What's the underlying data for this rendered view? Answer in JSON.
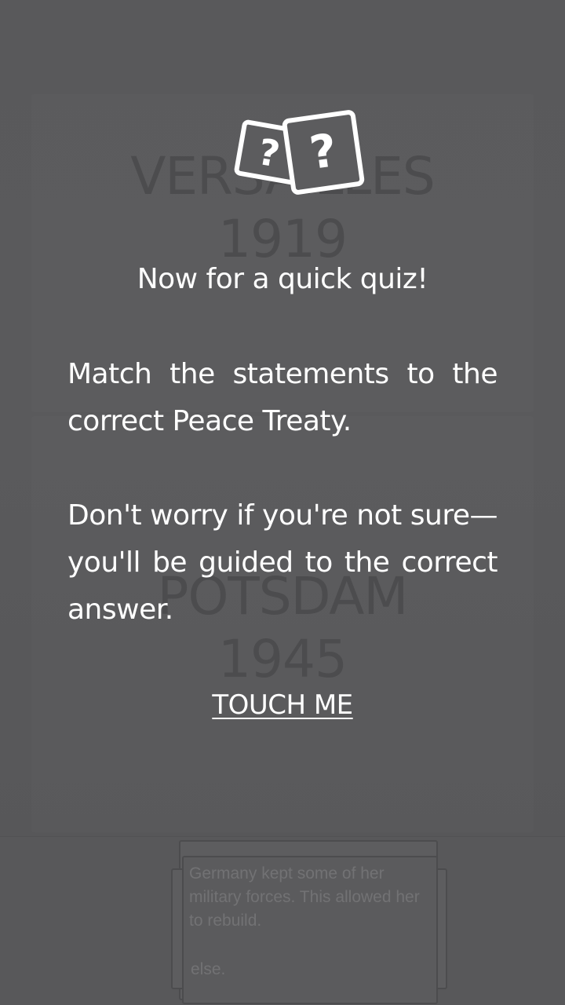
{
  "background": {
    "treaty_1": {
      "name": "VERSAILLES",
      "year": "1919"
    },
    "treaty_2": {
      "name": "POTSDAM",
      "year": "1945"
    },
    "statement_card": {
      "text": "Germany kept some of her military forces. This allowed her to rebuild.",
      "trailing_text": "else."
    }
  },
  "dialog": {
    "icon": "question-cards-icon",
    "heading": "Now for a quick quiz!",
    "paragraph_1": "Match the statements to the correct Peace Treaty.",
    "paragraph_2": "Don't worry if you're not sure—you'll be guided to the correct answer.",
    "action_label": "TOUCH ME"
  },
  "colors": {
    "overlay_background": "#5c5c5e",
    "text": "#ffffff",
    "dimmed_text": "#4c4c4e"
  }
}
